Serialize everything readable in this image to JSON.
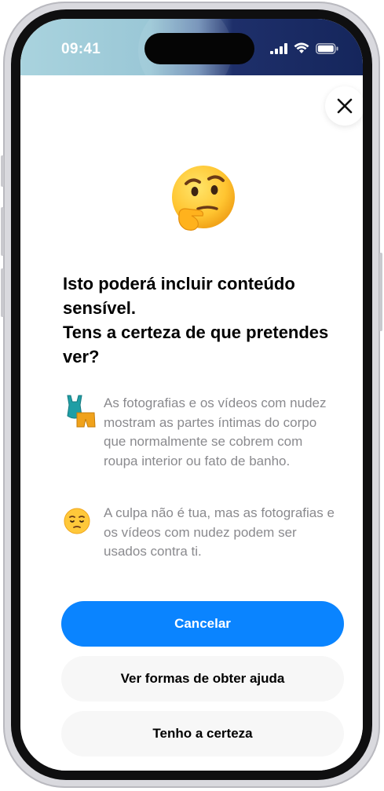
{
  "status_bar": {
    "time": "09:41",
    "icons": [
      "cellular-signal-icon",
      "wifi-icon",
      "battery-icon"
    ]
  },
  "close": {
    "icon": "close-icon"
  },
  "hero_emoji": "🤔",
  "headline": {
    "line1": "Isto poderá incluir conteúdo sensível.",
    "line2": "Tens a certeza de que pretendes ver?"
  },
  "info_items": [
    {
      "emoji": "👙🩳",
      "text": "As fotografias e os vídeos com nudez mostram as partes íntimas do corpo que normalmente se cobrem com roupa interior ou fato de banho."
    },
    {
      "emoji": "😔",
      "text": "A culpa não é tua, mas as fotografias e os vídeos com nudez podem ser usados contra ti."
    }
  ],
  "buttons": {
    "cancel": "Cancelar",
    "get_help": "Ver formas de obter ajuda",
    "sure": "Tenho a certeza"
  },
  "colors": {
    "primary": "#0a84ff",
    "secondary_bg": "#f7f7f7",
    "body_text": "#8a8a8e"
  }
}
